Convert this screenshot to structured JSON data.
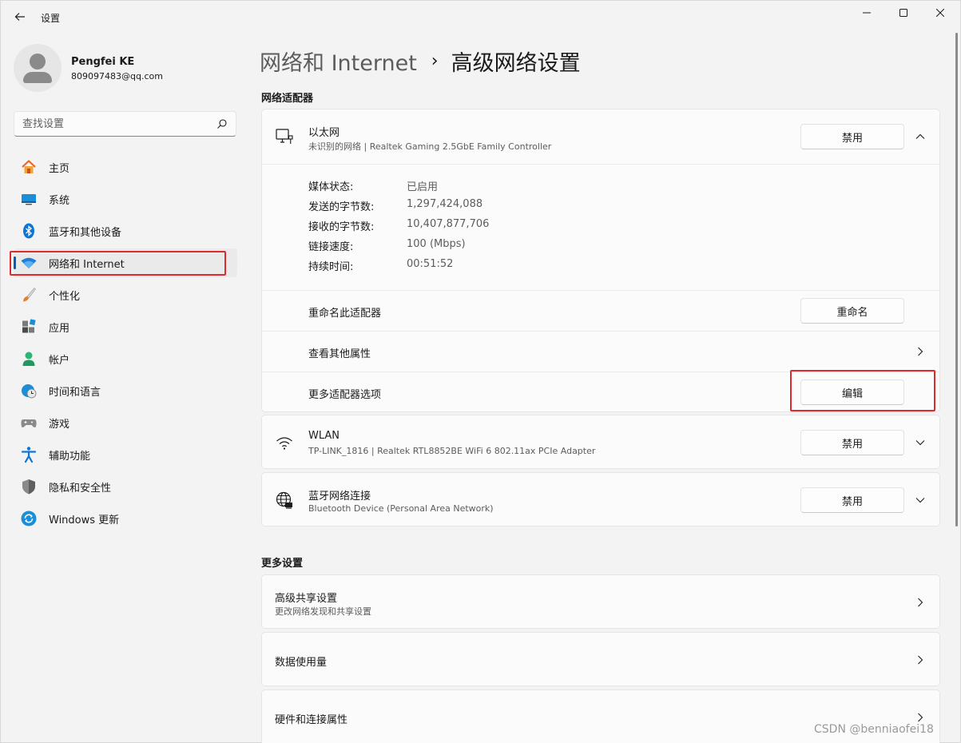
{
  "window": {
    "title": "设置"
  },
  "profile": {
    "name": "Pengfei KE",
    "email": "809097483@qq.com"
  },
  "search": {
    "placeholder": "查找设置"
  },
  "nav": {
    "items": [
      {
        "label": "主页",
        "icon": "home-icon"
      },
      {
        "label": "系统",
        "icon": "monitor-icon"
      },
      {
        "label": "蓝牙和其他设备",
        "icon": "bluetooth-icon"
      },
      {
        "label": "网络和 Internet",
        "icon": "wifi-icon",
        "selected": true
      },
      {
        "label": "个性化",
        "icon": "brush-icon"
      },
      {
        "label": "应用",
        "icon": "apps-icon"
      },
      {
        "label": "帐户",
        "icon": "person-icon"
      },
      {
        "label": "时间和语言",
        "icon": "clock-globe-icon"
      },
      {
        "label": "游戏",
        "icon": "gamepad-icon"
      },
      {
        "label": "辅助功能",
        "icon": "accessibility-icon"
      },
      {
        "label": "隐私和安全性",
        "icon": "shield-icon"
      },
      {
        "label": "Windows 更新",
        "icon": "update-icon"
      }
    ]
  },
  "breadcrumb": {
    "parent": "网络和 Internet",
    "separator": "›",
    "current": "高级网络设置"
  },
  "adapters": {
    "section_label": "网络适配器",
    "ethernet": {
      "title": "以太网",
      "subtitle": "未识别的网络 | Realtek Gaming 2.5GbE Family Controller",
      "button": "禁用",
      "details": [
        {
          "key": "媒体状态:",
          "value": "已启用"
        },
        {
          "key": "发送的字节数:",
          "value": "1,297,424,088"
        },
        {
          "key": "接收的字节数:",
          "value": "10,407,877,706"
        },
        {
          "key": "链接速度:",
          "value": "100 (Mbps)"
        },
        {
          "key": "持续时间:",
          "value": "00:51:52"
        }
      ],
      "rename_label": "重命名此适配器",
      "rename_button": "重命名",
      "view_props_label": "查看其他属性",
      "more_options_label": "更多适配器选项",
      "edit_button": "编辑"
    },
    "wlan": {
      "title": "WLAN",
      "subtitle": "TP-LINK_1816 | Realtek RTL8852BE WiFi 6 802.11ax PCIe Adapter",
      "button": "禁用"
    },
    "bluetooth": {
      "title": "蓝牙网络连接",
      "subtitle": "Bluetooth Device (Personal Area Network)",
      "button": "禁用"
    }
  },
  "more_settings": {
    "section_label": "更多设置",
    "sharing": {
      "title": "高级共享设置",
      "subtitle": "更改网络发现和共享设置"
    },
    "data_usage": {
      "title": "数据使用量"
    },
    "hardware": {
      "title": "硬件和连接属性"
    }
  },
  "watermark": "CSDN @benniaofei18",
  "colors": {
    "accent": "#005fb8",
    "highlight": "#e0282f"
  }
}
